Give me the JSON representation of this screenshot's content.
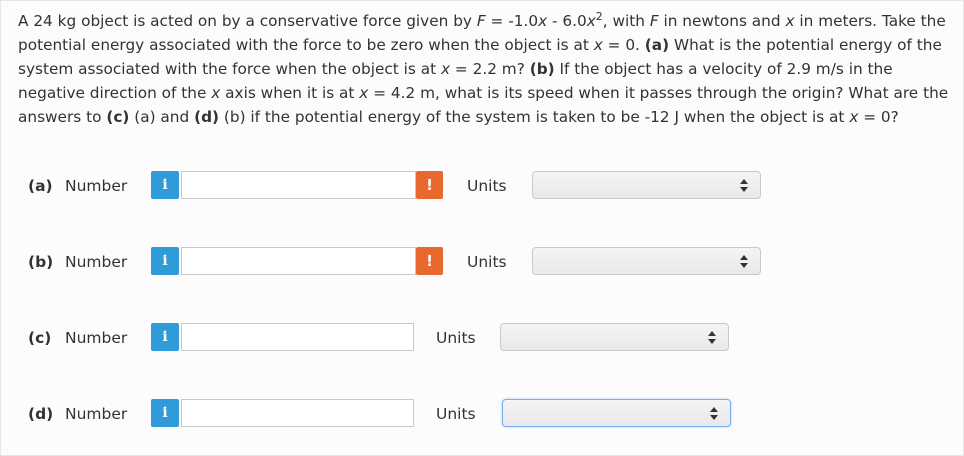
{
  "problem": {
    "intro": "A 24 kg object is acted on by a conservative force given by",
    "var_F": "F",
    "equation_lhs": " = -1.0",
    "var_x1": "x",
    "equation_mid": " - 6.0",
    "var_x2": "x",
    "exponent": "2",
    "after_eq": ", with",
    "var_F2": "F",
    "units_text": " in newtons and",
    "var_x3": "x",
    "units_text2": " in meters. Take the potential energy associated with the force to be zero when the object is at",
    "var_x4": "x",
    "cond1": " = 0.",
    "label_a": "(a)",
    "text_a": " What is the potential energy of the system associated with the force when the object is at",
    "var_x5": "x",
    "cond_a": " = 2.2 m?",
    "label_b": "(b)",
    "text_b": " If the object has a velocity of 2.9 m/s in the negative direction of the",
    "var_x6": "x",
    "text_b2": " axis when it is at",
    "var_x7": "x",
    "cond_b": " = 4.2 m, what is its speed when it passes through the origin? What are the answers to",
    "label_c": "(c)",
    "text_c": " (a) and",
    "label_d": "(d)",
    "text_d": " (b) if the potential energy of the system is taken to be -12 J when the object is at",
    "var_x8": "x",
    "cond_d": " = 0?"
  },
  "rows": [
    {
      "part": "(a)",
      "number_label": "Number",
      "info_icon": "i",
      "value": "",
      "warn_icon": "!",
      "units_label": "Units",
      "units_selected": ""
    },
    {
      "part": "(b)",
      "number_label": "Number",
      "info_icon": "i",
      "value": "",
      "warn_icon": "!",
      "units_label": "Units",
      "units_selected": ""
    },
    {
      "part": "(c)",
      "number_label": "Number",
      "info_icon": "i",
      "value": "",
      "units_label": "Units",
      "units_selected": ""
    },
    {
      "part": "(d)",
      "number_label": "Number",
      "info_icon": "i",
      "value": "",
      "units_label": "Units",
      "units_selected": ""
    }
  ],
  "colors": {
    "info": "#2f9bd9",
    "warning": "#e8692d",
    "focus_border": "#79aef0"
  }
}
